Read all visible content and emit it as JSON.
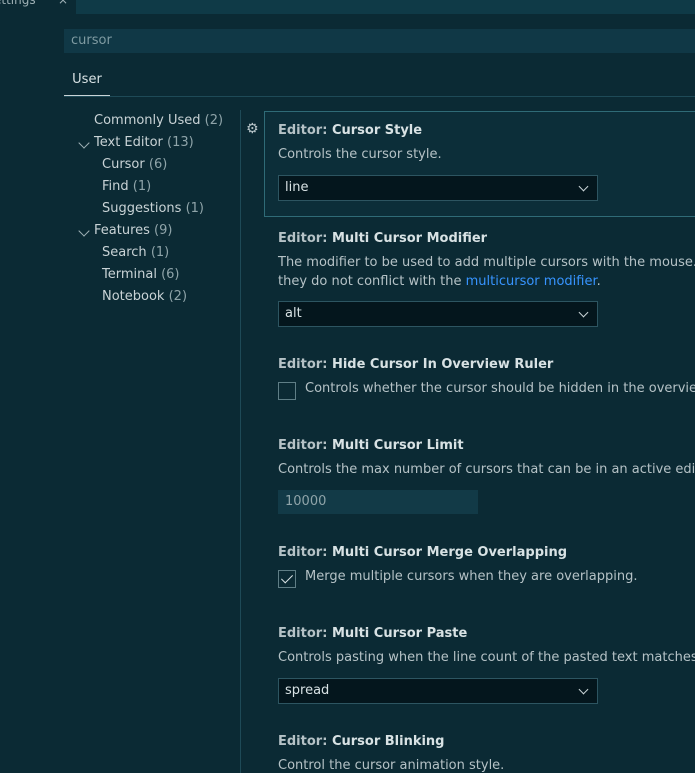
{
  "editor_tab": {
    "label": "ettings",
    "close": "×"
  },
  "search": {
    "value": "cursor"
  },
  "scope": {
    "user_tab": "User"
  },
  "toc": [
    {
      "label": "Commonly Used",
      "count": "(2)"
    },
    {
      "label": "Text Editor",
      "count": "(13)"
    },
    {
      "label": "Cursor",
      "count": "(6)"
    },
    {
      "label": "Find",
      "count": "(1)"
    },
    {
      "label": "Suggestions",
      "count": "(1)"
    },
    {
      "label": "Features",
      "count": "(9)"
    },
    {
      "label": "Search",
      "count": "(1)"
    },
    {
      "label": "Terminal",
      "count": "(6)"
    },
    {
      "label": "Notebook",
      "count": "(2)"
    }
  ],
  "settings": {
    "cursor_style": {
      "category": "Editor: ",
      "name": "Cursor Style",
      "description": "Controls the cursor style.",
      "value": "line"
    },
    "multi_cursor_modifier": {
      "category": "Editor: ",
      "name": "Multi Cursor Modifier",
      "description_line1": "The modifier to be used to add multiple cursors with the mouse.",
      "description_line2_pre": "they do not conflict with the ",
      "description_link": "multicursor modifier",
      "description_line2_post": ".",
      "value": "alt"
    },
    "hide_cursor_overview": {
      "category": "Editor: ",
      "name": "Hide Cursor In Overview Ruler",
      "label": "Controls whether the cursor should be hidden in the overvie",
      "checked": false
    },
    "multi_cursor_limit": {
      "category": "Editor: ",
      "name": "Multi Cursor Limit",
      "description": "Controls the max number of cursors that can be in an active edi",
      "value": "10000"
    },
    "multi_cursor_merge": {
      "category": "Editor: ",
      "name": "Multi Cursor Merge Overlapping",
      "label": "Merge multiple cursors when they are overlapping.",
      "checked": true
    },
    "multi_cursor_paste": {
      "category": "Editor: ",
      "name": "Multi Cursor Paste",
      "description": "Controls pasting when the line count of the pasted text matches",
      "value": "spread"
    },
    "cursor_blinking": {
      "category": "Editor: ",
      "name": "Cursor Blinking",
      "description": "Control the cursor animation style."
    }
  }
}
